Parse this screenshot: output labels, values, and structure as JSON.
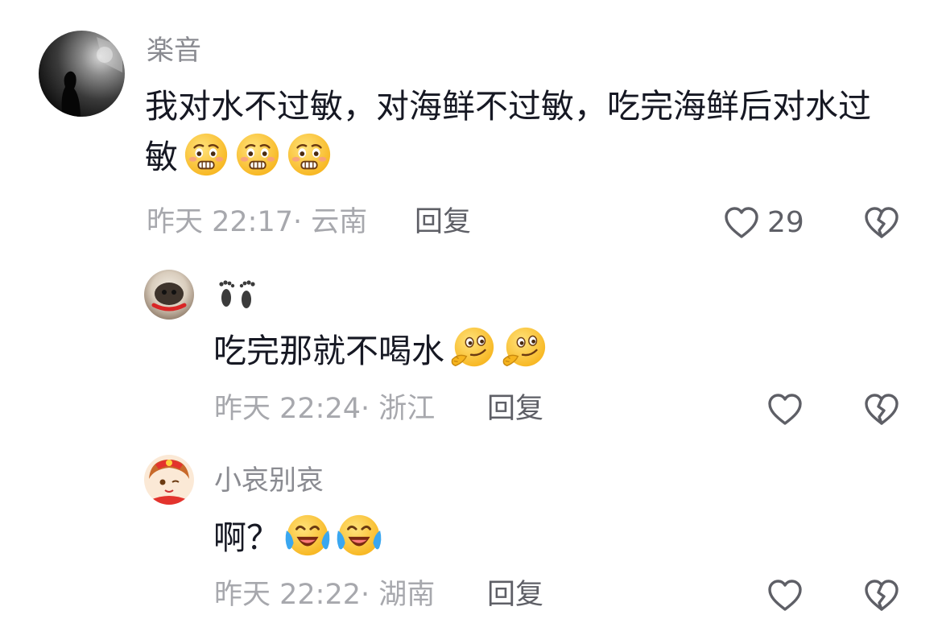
{
  "comments": [
    {
      "author": "楽音",
      "text": "我对水不过敏，对海鲜不过敏，吃完海鲜后对水过敏",
      "emojis": [
        "nervous-face-emoji",
        "nervous-face-emoji",
        "nervous-face-emoji"
      ],
      "time": "昨天 22:17",
      "location": "云南",
      "reply_label": "回复",
      "likes": "29"
    },
    {
      "author_icon": "footprints-icon",
      "text": "吃完那就不喝水",
      "emojis": [
        "thinking-face-emoji",
        "thinking-face-emoji"
      ],
      "time": "昨天 22:24",
      "location": "浙江",
      "reply_label": "回复",
      "likes": ""
    },
    {
      "author": "小哀别哀",
      "text": "啊？",
      "emojis": [
        "crying-laughing-emoji",
        "crying-laughing-emoji"
      ],
      "time": "昨天 22:22",
      "location": "湖南",
      "reply_label": "回复",
      "likes": ""
    }
  ],
  "colors": {
    "text": "#161823",
    "name": "#8a8b91",
    "meta": "#a7a8ad",
    "action": "#5e5f66",
    "emoji_yellow": "#ffcc33"
  }
}
